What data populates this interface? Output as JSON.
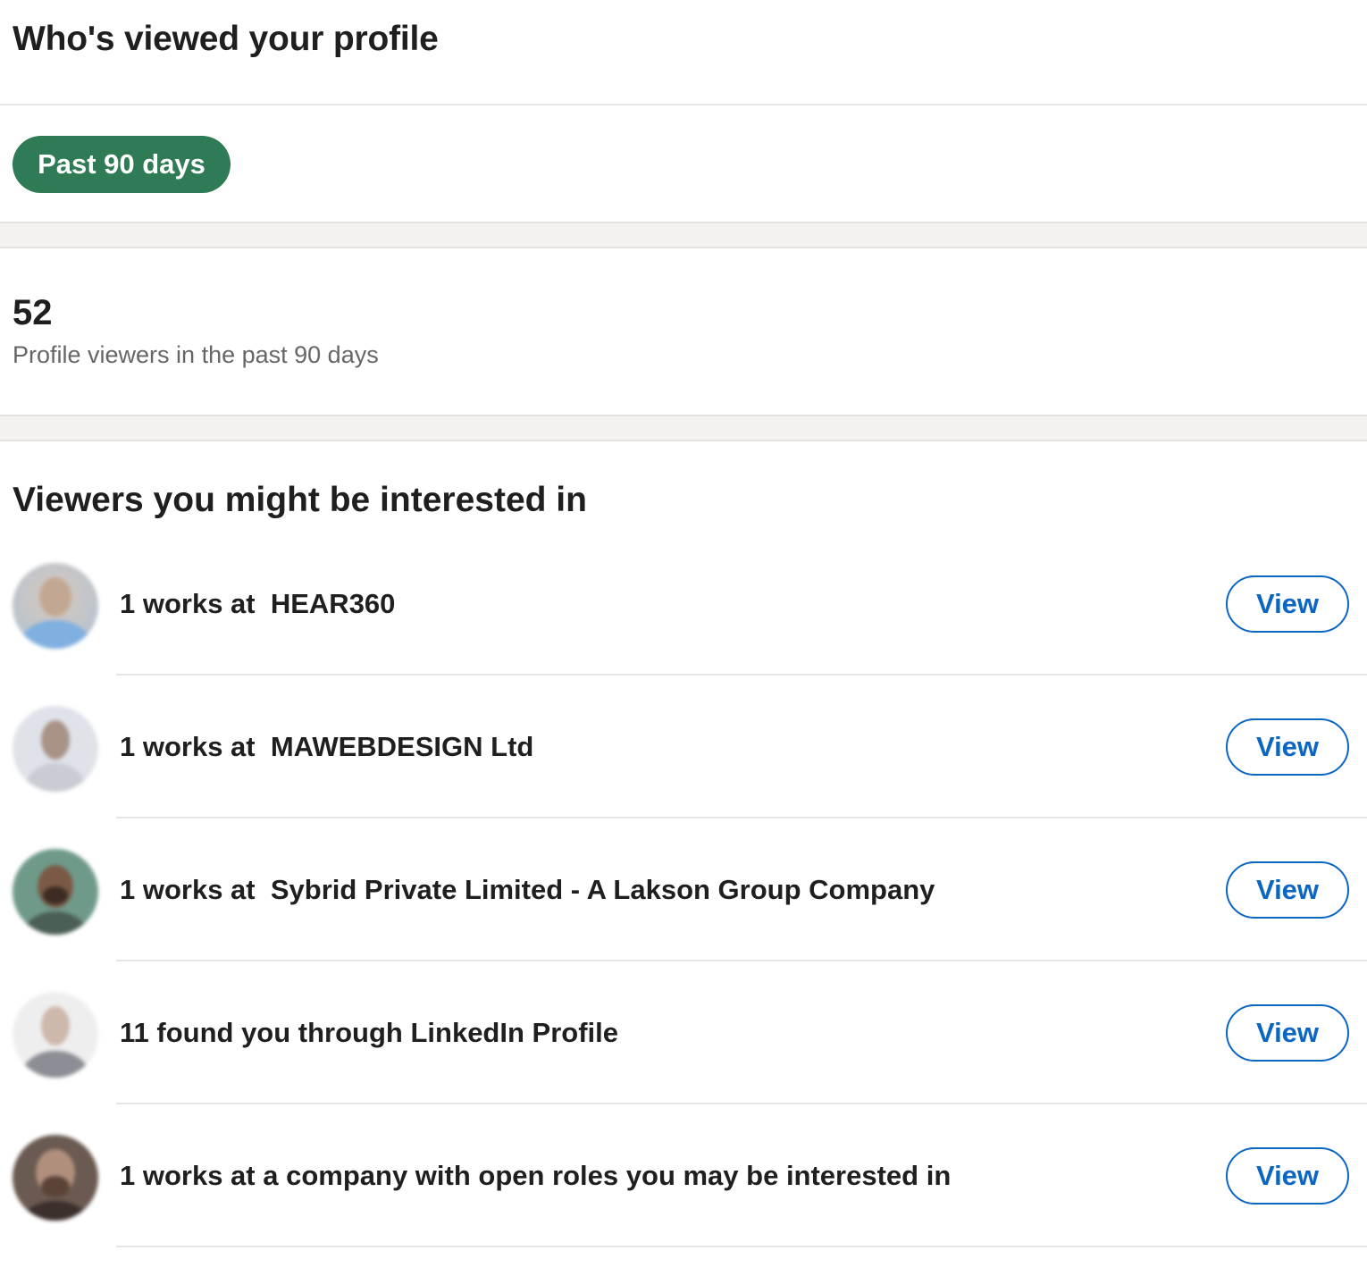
{
  "header": {
    "title": "Who's viewed your profile"
  },
  "filter": {
    "label": "Past 90 days"
  },
  "stats": {
    "count": "52",
    "label": "Profile viewers in the past 90 days"
  },
  "viewers_section": {
    "title": "Viewers you might be interested in",
    "items": [
      {
        "text": "1 works at  HEAR360",
        "button": "View",
        "avatar": "blurred-person-light-blue"
      },
      {
        "text": "1 works at  MAWEBDESIGN Ltd",
        "button": "View",
        "avatar": "blurred-person-grey"
      },
      {
        "text": "1 works at  Sybrid Private Limited - A Lakson Group Company",
        "button": "View",
        "avatar": "blurred-person-green"
      },
      {
        "text": "11 found you through LinkedIn Profile",
        "button": "View",
        "avatar": "blurred-person-light"
      },
      {
        "text": "1 works at a company with open roles you may be interested in",
        "button": "View",
        "avatar": "blurred-person-brown"
      }
    ]
  },
  "colors": {
    "filter_pill": "#2e7b55",
    "link_blue": "#0a66c2",
    "section_gap": "#f3f2ee"
  }
}
